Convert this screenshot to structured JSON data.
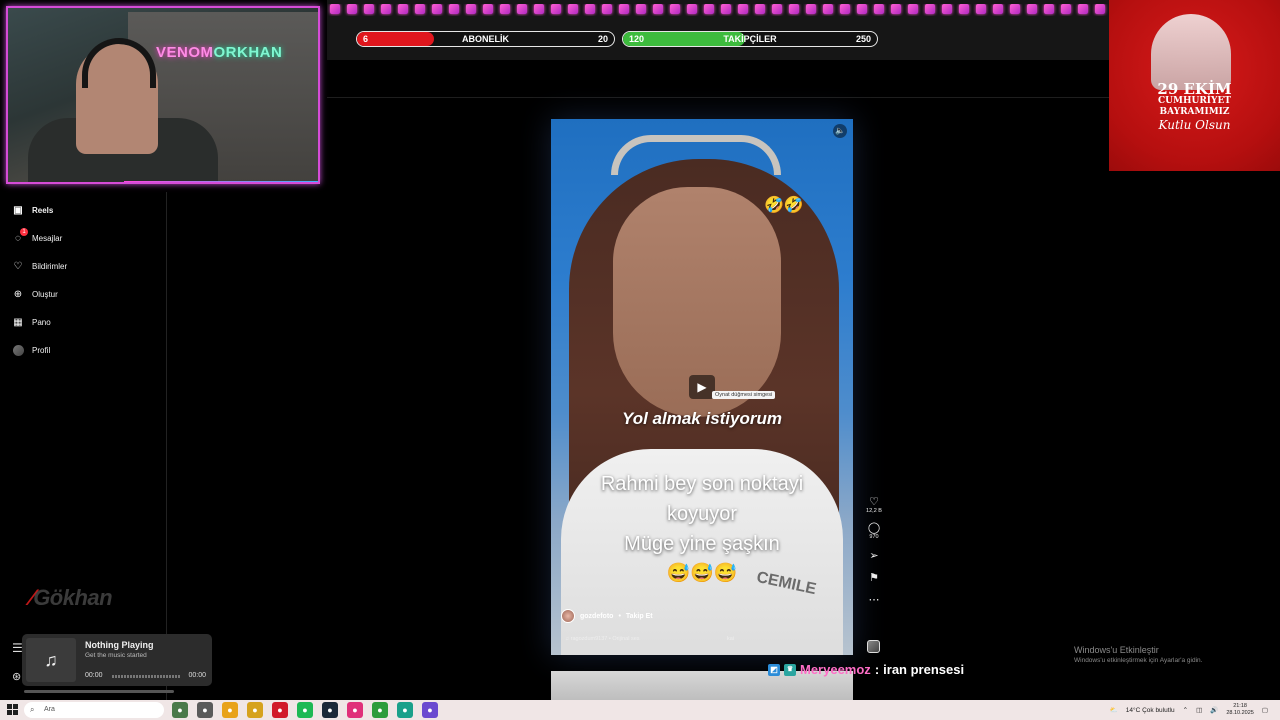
{
  "overlay": {
    "subs": {
      "current": "6",
      "label": "ABONELİK",
      "goal": "20",
      "fill": 0.3,
      "color": "#e0161d"
    },
    "followers": {
      "current": "120",
      "label": "TAKİPÇİLER",
      "goal": "250",
      "fill": 0.48,
      "color": "#3dbb3d"
    },
    "webcam_neon": {
      "part1": "VENOM",
      "part2": "ORKHAN"
    }
  },
  "sidebar": {
    "items": [
      {
        "label": "Reels",
        "icon": "reels-icon",
        "active": true
      },
      {
        "label": "Mesajlar",
        "icon": "messenger-icon",
        "badge": "1"
      },
      {
        "label": "Bildirimler",
        "icon": "heart-icon"
      },
      {
        "label": "Oluştur",
        "icon": "plus-icon"
      },
      {
        "label": "Pano",
        "icon": "dashboard-icon"
      },
      {
        "label": "Profil",
        "icon": "avatar-icon"
      }
    ]
  },
  "watermark": {
    "text": "Gökhan"
  },
  "music": {
    "title": "Nothing Playing",
    "subtitle": "Get the music started",
    "time_start": "00:00",
    "time_end": "00:00"
  },
  "reel": {
    "emoji_top": "🤣🤣",
    "caption_1": "Yol almak istiyorum",
    "caption_2_line1": "Rahmi bey son noktayi",
    "caption_2_line2": "koyuyor",
    "caption_2_line3": "Müge yine şaşkın",
    "emoji_bottom": "😅😅😅",
    "shirt_text": "CEMILE",
    "play_tooltip": "Oynat düğmesi simgesi",
    "author": "gozdefoto",
    "follow": "Takip Et",
    "audio": "♫ ragozdum9137 • Orijinal ses",
    "audio_extra": "kai",
    "likes": "12,2 B",
    "comments": "970"
  },
  "chat": {
    "user": "Meryeemoz",
    "separator": ":",
    "message": "iran prensesi"
  },
  "banner": {
    "line1": "29 EKİM",
    "line2": "CUMHURİYET",
    "line3": "BAYRAMIMIZ",
    "line4": "Kutlu Olsun"
  },
  "windows_activation": {
    "line1": "Windows'u Etkinleştir",
    "line2": "Windows'u etkinleştirmek için Ayarlar'a gidin."
  },
  "taskbar": {
    "search_placeholder": "Ara",
    "weather": "14°C Çok bulutlu",
    "time": "21:18",
    "date": "28.10.2025",
    "apps": [
      {
        "icon": "widget-icon",
        "color": "#4a7a4a"
      },
      {
        "icon": "task-view-icon",
        "color": "#5a5a5a"
      },
      {
        "icon": "chrome-icon",
        "color": "#e8a21a"
      },
      {
        "icon": "folder-icon",
        "color": "#d6a21e"
      },
      {
        "icon": "opera-icon",
        "color": "#d11a2a"
      },
      {
        "icon": "spotify-icon",
        "color": "#1db954"
      },
      {
        "icon": "steam-icon",
        "color": "#1b2838"
      },
      {
        "icon": "app-pink-icon",
        "color": "#e0307a"
      },
      {
        "icon": "app-green-icon",
        "color": "#2d9c3c"
      },
      {
        "icon": "app-teal-icon",
        "color": "#1aa08a"
      },
      {
        "icon": "app-purple-icon",
        "color": "#6b4ad0"
      }
    ]
  }
}
